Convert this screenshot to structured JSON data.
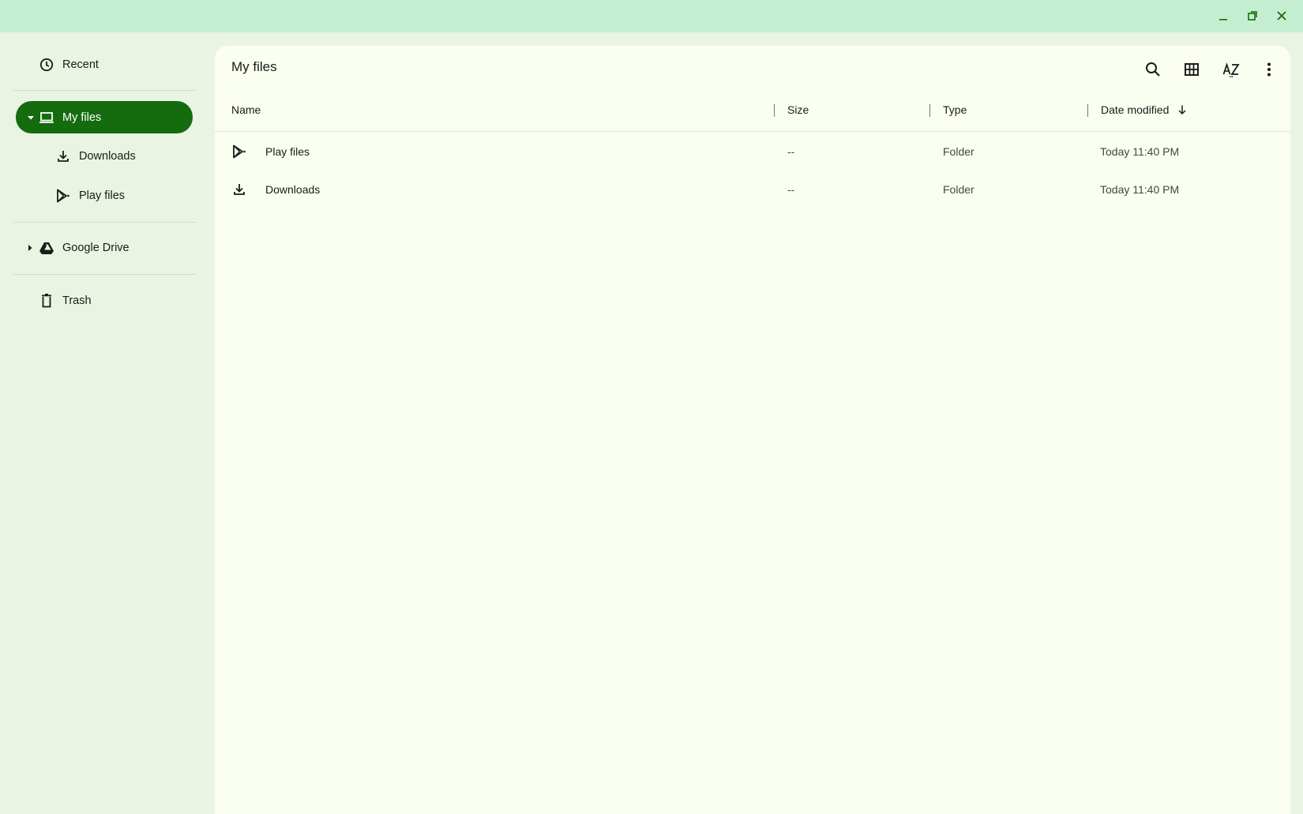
{
  "window": {
    "controls": {
      "minimize_icon": "minimize-icon",
      "restore_icon": "restore-icon",
      "close_icon": "close-icon"
    }
  },
  "sidebar": {
    "recent": {
      "label": "Recent",
      "icon": "clock-icon"
    },
    "my_files": {
      "label": "My files",
      "icon": "laptop-icon",
      "expanded": true,
      "selected": true
    },
    "my_files_children": [
      {
        "label": "Downloads",
        "icon": "download-icon"
      },
      {
        "label": "Play files",
        "icon": "play-icon"
      }
    ],
    "google_drive": {
      "label": "Google Drive",
      "icon": "drive-icon",
      "expanded": false
    },
    "trash": {
      "label": "Trash",
      "icon": "trash-icon"
    }
  },
  "main": {
    "title": "My files",
    "toolbar": {
      "search_icon": "search-icon",
      "grid_view_icon": "grid-icon",
      "sort_icon": "sort-az-icon",
      "more_icon": "more-vert-icon"
    },
    "columns": {
      "name": "Name",
      "size": "Size",
      "type": "Type",
      "date_modified": "Date modified",
      "sort_direction_icon": "arrow-down-icon"
    },
    "rows": [
      {
        "icon": "play-icon",
        "name": "Play files",
        "size": "--",
        "type": "Folder",
        "date": "Today 11:40 PM"
      },
      {
        "icon": "download-icon",
        "name": "Downloads",
        "size": "--",
        "type": "Folder",
        "date": "Today 11:40 PM"
      }
    ]
  },
  "colors": {
    "background": "#e9f5e2",
    "titlebar": "#c5edcf",
    "panel": "#fafff2",
    "accent": "#146c0e",
    "window_icons": "#146c0e"
  }
}
